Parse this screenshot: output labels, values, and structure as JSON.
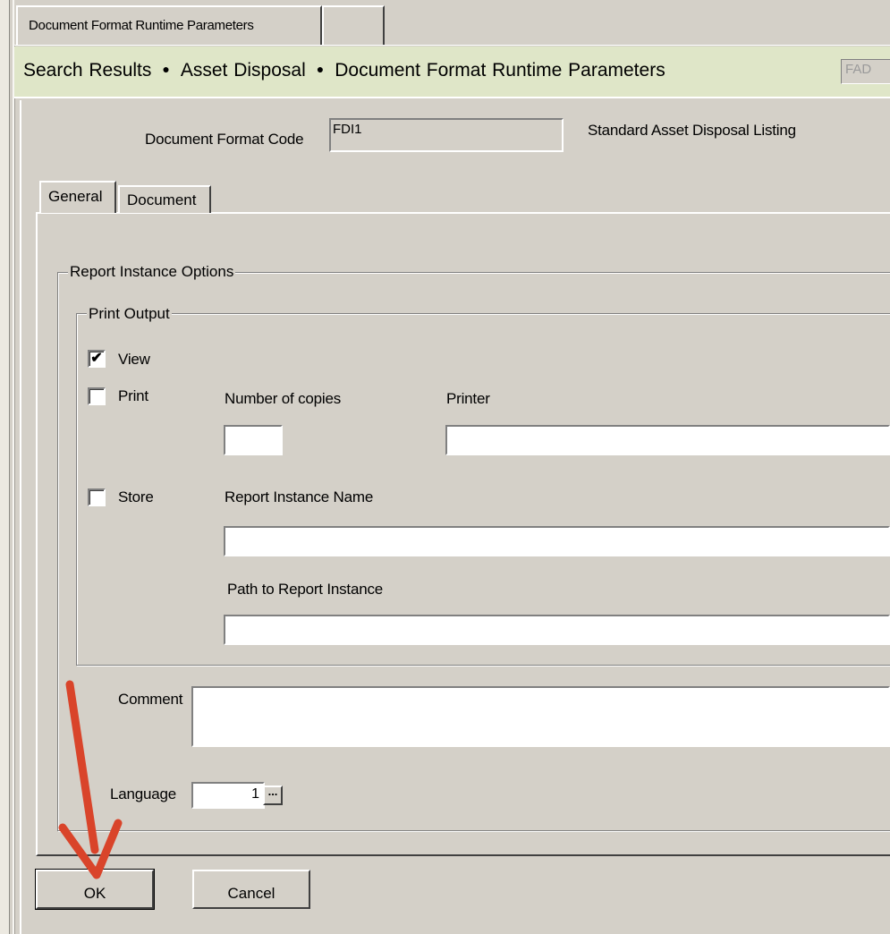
{
  "window_tabs": [
    {
      "label": "Document Format Runtime Parameters"
    },
    {
      "label": ""
    }
  ],
  "breadcrumb": {
    "items": [
      "Search Results",
      "Asset Disposal",
      "Document Format Runtime Parameters"
    ],
    "separator": "●",
    "right_field_value": "FAD"
  },
  "header": {
    "doc_format_label": "Document Format Code",
    "doc_format_value": "FDI1",
    "doc_format_description": "Standard Asset Disposal Listing"
  },
  "tabs": [
    {
      "label": "General",
      "active": true
    },
    {
      "label": "Document",
      "active": false
    }
  ],
  "report_options": {
    "title": "Report Instance Options",
    "print_output": {
      "title": "Print Output",
      "view": {
        "label": "View",
        "checked": true
      },
      "print": {
        "label": "Print",
        "checked": false
      },
      "store": {
        "label": "Store",
        "checked": false
      },
      "copies_label": "Number of copies",
      "copies_value": "",
      "printer_label": "Printer",
      "printer_value": "",
      "instance_name_label": "Report Instance Name",
      "instance_name_value": "",
      "instance_path_label": "Path to Report Instance",
      "instance_path_value": ""
    },
    "comment_label": "Comment",
    "comment_value": "",
    "language_label": "Language",
    "language_value": "1",
    "language_button": "..."
  },
  "buttons": {
    "ok": "OK",
    "cancel": "Cancel"
  },
  "colors": {
    "background": "#d4d0c8",
    "breadcrumb_bg": "#dfe6c8",
    "annotation_arrow": "#d9442a"
  }
}
